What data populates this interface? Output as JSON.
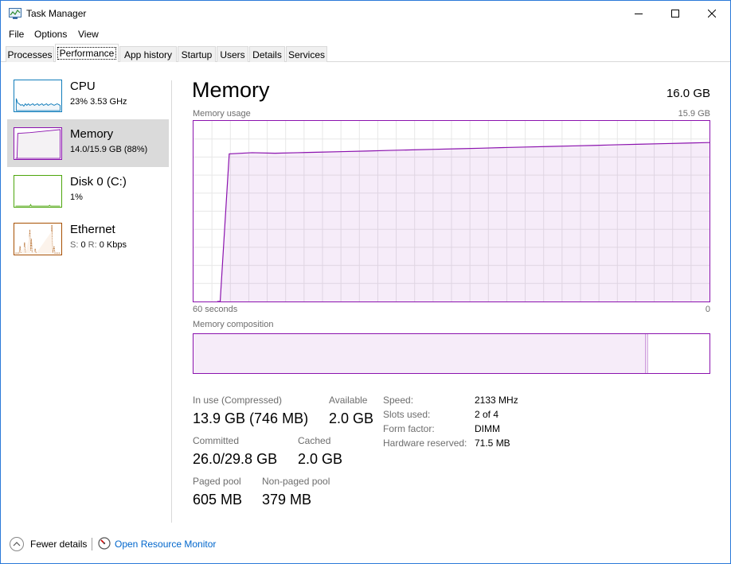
{
  "window": {
    "title": "Task Manager"
  },
  "menu": {
    "items": [
      "File",
      "Options",
      "View"
    ]
  },
  "tabs": [
    "Processes",
    "Performance",
    "App history",
    "Startup",
    "Users",
    "Details",
    "Services"
  ],
  "sidebar": {
    "items": [
      {
        "name": "CPU",
        "sub": "23%  3.53 GHz",
        "color": "#117dbb"
      },
      {
        "name": "Memory",
        "sub": "14.0/15.9 GB (88%)",
        "color": "#8b12ae"
      },
      {
        "name": "Disk 0 (C:)",
        "sub": "1%",
        "color": "#4da60c"
      },
      {
        "name": "Ethernet",
        "sub_s_label": "S:",
        "sub_s_value": "0",
        "sub_r_label": "R:",
        "sub_r_value": "0 Kbps",
        "color": "#a74f01"
      }
    ]
  },
  "main": {
    "title": "Memory",
    "total": "16.0 GB",
    "usage_label": "Memory usage",
    "usage_max": "15.9 GB",
    "axis_left": "60 seconds",
    "axis_right": "0",
    "composition_label": "Memory composition"
  },
  "chart_data": {
    "type": "area",
    "series": [
      {
        "values": [
          0,
          0,
          0,
          0,
          13.0,
          13.1,
          13.05,
          13.1,
          13.15,
          13.2,
          13.25,
          13.3,
          13.35,
          13.4,
          13.45,
          13.5,
          13.55,
          13.6,
          13.65,
          13.7,
          13.75,
          13.8,
          13.85,
          13.9,
          13.95,
          14.0
        ]
      }
    ],
    "ylim": [
      0,
      15.9
    ],
    "grid": true,
    "composition": {
      "in_use_fraction": 0.876,
      "modified_fraction": 0.004
    }
  },
  "stats": {
    "in_use_label": "In use (Compressed)",
    "in_use_value": "13.9 GB (746 MB)",
    "available_label": "Available",
    "available_value": "2.0 GB",
    "committed_label": "Committed",
    "committed_value": "26.0/29.8 GB",
    "cached_label": "Cached",
    "cached_value": "2.0 GB",
    "paged_label": "Paged pool",
    "paged_value": "605 MB",
    "nonpaged_label": "Non-paged pool",
    "nonpaged_value": "379 MB"
  },
  "details": [
    {
      "label": "Speed:",
      "value": "2133 MHz"
    },
    {
      "label": "Slots used:",
      "value": "2 of 4"
    },
    {
      "label": "Form factor:",
      "value": "DIMM"
    },
    {
      "label": "Hardware reserved:",
      "value": "71.5 MB"
    }
  ],
  "footer": {
    "fewer_details": "Fewer details",
    "open_resmon": "Open Resource Monitor"
  }
}
